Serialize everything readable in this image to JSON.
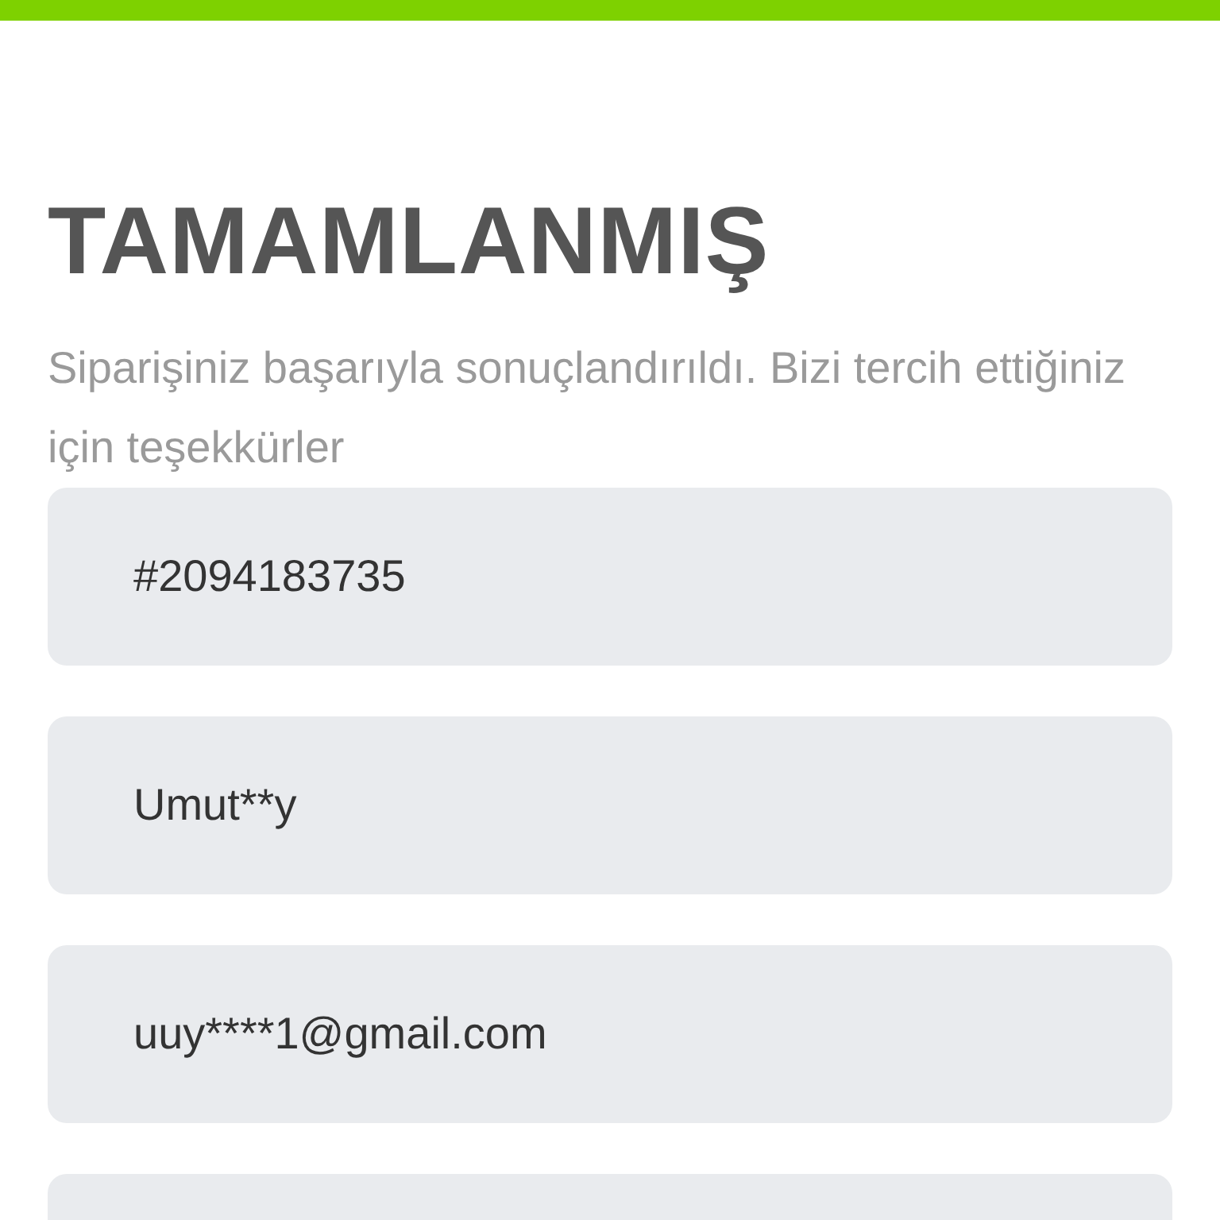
{
  "title": "TAMAMLANMIŞ",
  "message": "Siparişiniz başarıyla sonuçlandırıldı. Bizi tercih ettiğiniz için teşekkürler",
  "fields": [
    {
      "value": "#2094183735"
    },
    {
      "value": "Umut**y"
    },
    {
      "value": "uuy****1@gmail.com"
    }
  ]
}
